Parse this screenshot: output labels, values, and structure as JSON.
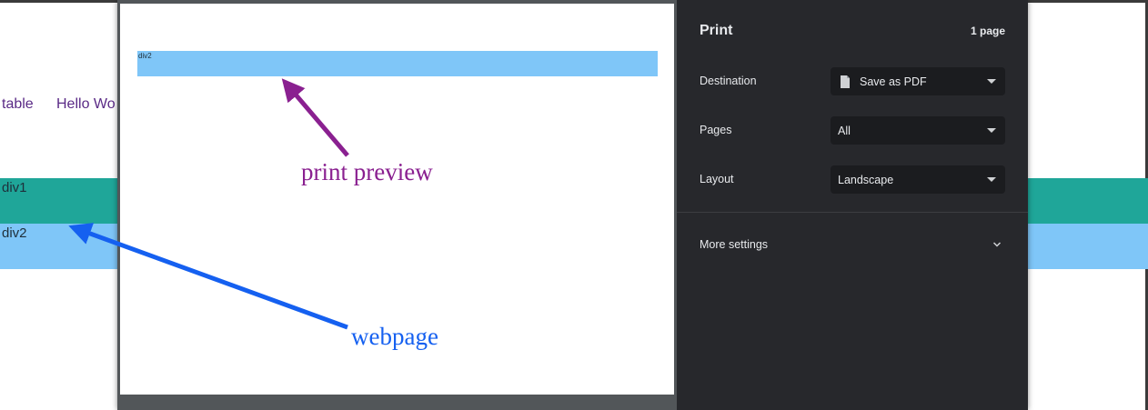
{
  "webpage": {
    "nav_links": [
      "table",
      "Hello Wo"
    ],
    "bands": [
      {
        "label": "div1",
        "color": "#1fa699"
      },
      {
        "label": "div2",
        "color": "#7fc6f8"
      }
    ]
  },
  "preview": {
    "bar_label": "div2"
  },
  "print_dialog": {
    "title": "Print",
    "page_count": "1 page",
    "destination": {
      "label": "Destination",
      "value": "Save as PDF",
      "icon": "document-icon"
    },
    "pages": {
      "label": "Pages",
      "value": "All"
    },
    "layout": {
      "label": "Layout",
      "value": "Landscape"
    },
    "more_settings": {
      "label": "More settings",
      "icon": "chevron-down-icon"
    }
  },
  "annotations": {
    "print_preview": {
      "text": "print preview",
      "color": "#8a2090"
    },
    "webpage": {
      "text": "webpage",
      "color": "#1560f0"
    }
  }
}
